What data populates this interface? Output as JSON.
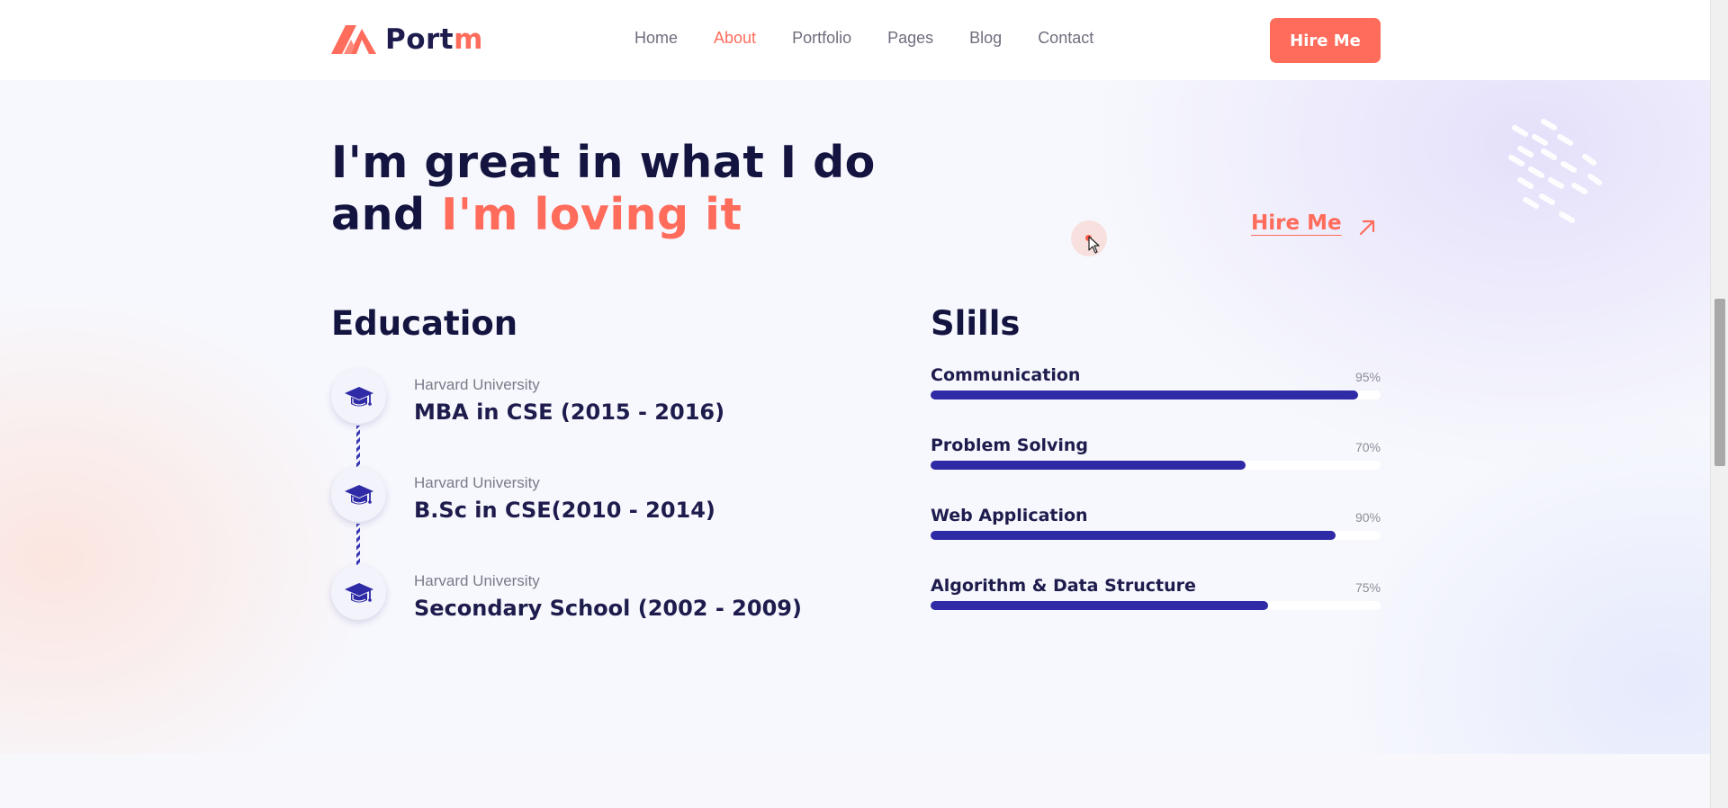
{
  "header": {
    "logo": {
      "part1": "Port",
      "part2": "m"
    },
    "nav": [
      "Home",
      "About",
      "Portfolio",
      "Pages",
      "Blog",
      "Contact"
    ],
    "active_nav": "About",
    "hire_button": "Hire Me"
  },
  "hero": {
    "line1": "I'm great in what I do",
    "line2_prefix": "and ",
    "line2_accent": "I'm loving it",
    "hire_link": "Hire Me"
  },
  "education": {
    "title": "Education",
    "items": [
      {
        "school": "Harvard University",
        "degree": "MBA in CSE (2015 - 2016)"
      },
      {
        "school": "Harvard University",
        "degree": "B.Sc in CSE(2010 - 2014)"
      },
      {
        "school": "Harvard University",
        "degree": "Secondary School (2002 - 2009)"
      }
    ]
  },
  "skills": {
    "title": "Slills",
    "items": [
      {
        "name": "Communication",
        "percent_label": "95%",
        "level": 0.95
      },
      {
        "name": "Problem Solving",
        "percent_label": "70%",
        "level": 0.7
      },
      {
        "name": "Web Application",
        "percent_label": "90%",
        "level": 0.9
      },
      {
        "name": "Algorithm & Data Structure",
        "percent_label": "75%",
        "level": 0.75
      }
    ]
  },
  "colors": {
    "accent": "#ff6c5c",
    "navy": "#141440",
    "bar": "#2f2aa6"
  },
  "icons": [
    "logo-mark-icon",
    "graduation-cap-icon",
    "arrow-up-right-icon",
    "mouse-pointer-icon"
  ]
}
